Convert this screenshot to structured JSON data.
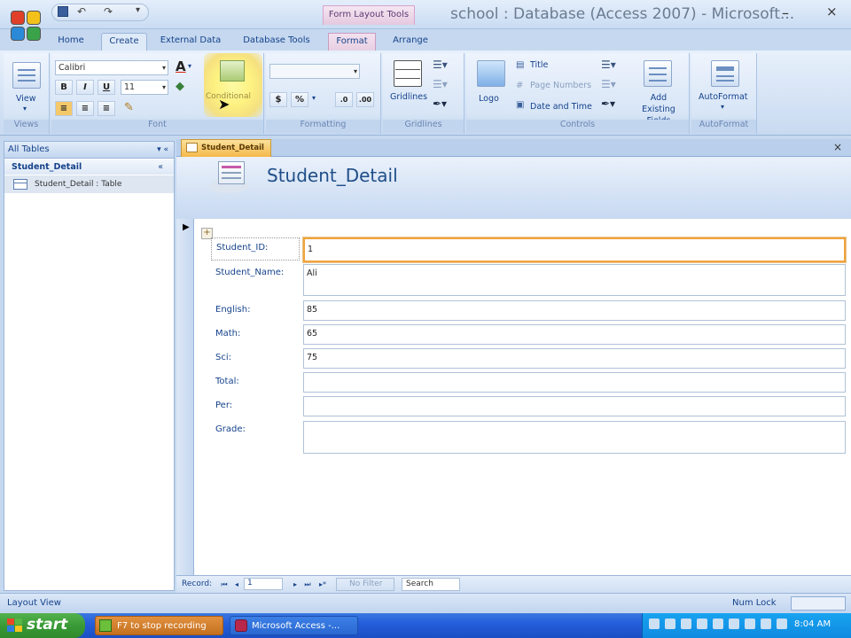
{
  "titlebar": {
    "contextual_tools_label": "Form Layout Tools",
    "window_title": "school : Database (Access 2007) - Microsoft...",
    "minimize_glyph": "–",
    "close_glyph": "×",
    "qat": {
      "save_icon": "save-icon",
      "undo_glyph": "↶",
      "redo_glyph": "↷",
      "customize_glyph": "▾"
    }
  },
  "ribbon_tabs": [
    {
      "label": "Home"
    },
    {
      "label": "Create"
    },
    {
      "label": "External Data"
    },
    {
      "label": "Database Tools"
    },
    {
      "label": "Format"
    },
    {
      "label": "Arrange"
    }
  ],
  "ribbon": {
    "views": {
      "group_label": "Views",
      "view_label": "View"
    },
    "font": {
      "group_label": "Font",
      "font_name": "Calibri",
      "font_size": "11",
      "bold": "B",
      "italic": "I",
      "underline": "U",
      "conditional_label": "Conditional"
    },
    "formatting": {
      "group_label": "Formatting",
      "currency": "$",
      "percent": "%",
      "decimals": ".0"
    },
    "gridlines": {
      "group_label": "Gridlines",
      "gridlines_label": "Gridlines"
    },
    "controls": {
      "group_label": "Controls",
      "logo_label": "Logo",
      "title_label": "Title",
      "page_numbers_label": "Page Numbers",
      "date_time_label": "Date and Time",
      "add_fields_label": "Add Existing Fields"
    },
    "autoformat": {
      "group_label": "AutoFormat",
      "autoformat_label": "AutoFormat"
    }
  },
  "nav_pane": {
    "header": "All Tables",
    "header_chevrons": "▾ «",
    "group": "Student_Detail",
    "group_chevron": "«",
    "item": "Student_Detail : Table"
  },
  "document": {
    "tab_label": "Student_Detail",
    "close_glyph": "×",
    "form_title": "Student_Detail"
  },
  "form": {
    "fields": [
      {
        "label": "Student_ID:",
        "value": "1"
      },
      {
        "label": "Student_Name:",
        "value": "Ali"
      },
      {
        "label": "English:",
        "value": "85"
      },
      {
        "label": "Math:",
        "value": "65"
      },
      {
        "label": "Sci:",
        "value": "75"
      },
      {
        "label": "Total:",
        "value": ""
      },
      {
        "label": "Per:",
        "value": ""
      },
      {
        "label": "Grade:",
        "value": ""
      }
    ]
  },
  "record_nav": {
    "record_label": "Record:",
    "current": "1",
    "first": "⏮",
    "prev": "◂",
    "next": "▸",
    "last": "⏭",
    "new": "▸*",
    "filter_label": "No Filter",
    "search_label": "Search"
  },
  "status_bar": {
    "left": "Layout View",
    "right": "Num Lock"
  },
  "taskbar": {
    "start_label": "start",
    "tasks": [
      {
        "label": "F7 to stop recording"
      },
      {
        "label": "Microsoft Access -..."
      }
    ],
    "clock": "8:04 AM"
  },
  "colors": {
    "accent_orange": "#f0a43c",
    "ribbon_blue": "#c8daf1",
    "taskbar_blue": "#245edb",
    "start_green": "#3a9a36"
  }
}
